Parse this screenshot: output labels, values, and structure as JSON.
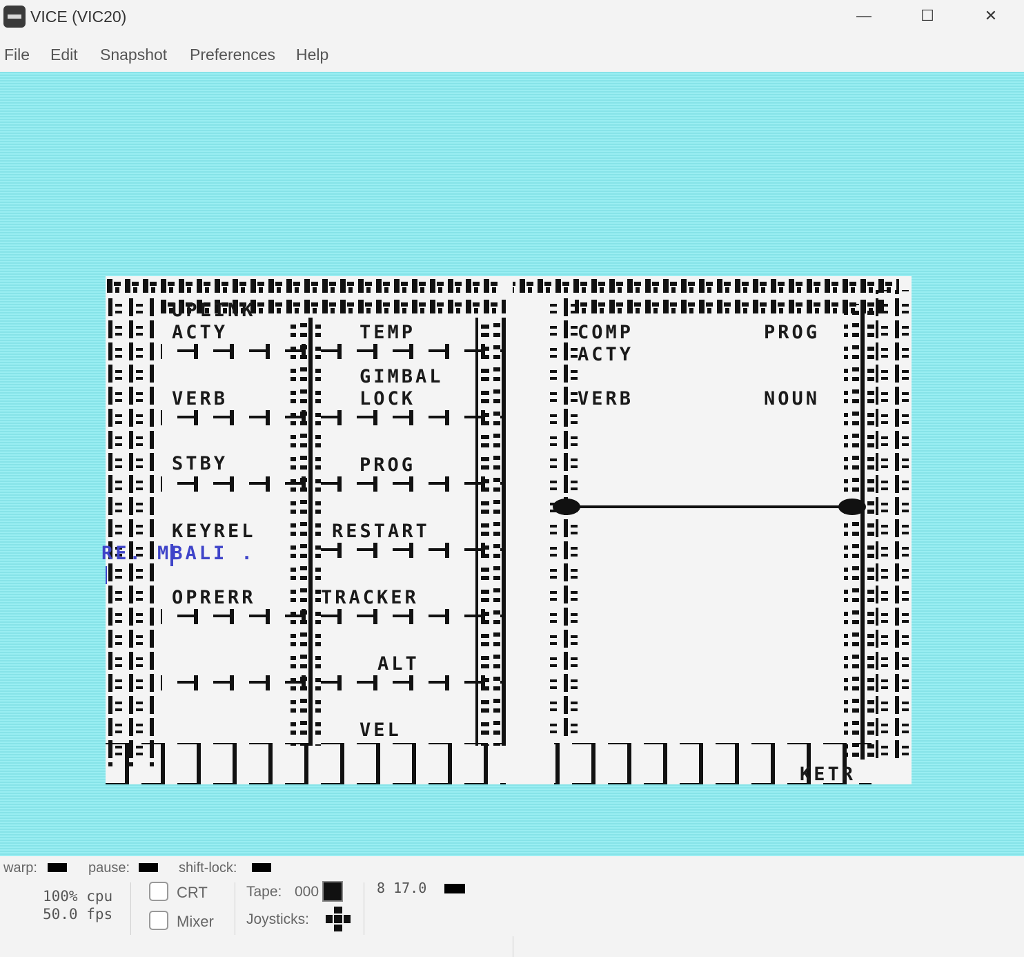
{
  "window": {
    "title": "VICE (VIC20)",
    "controls": {
      "minimize": "—",
      "maximize": "☐",
      "close": "✕"
    }
  },
  "menu": {
    "file": "File",
    "edit": "Edit",
    "snapshot": "Snapshot",
    "preferences": "Preferences",
    "help": "Help"
  },
  "screen": {
    "border_color": "#8ce6eb",
    "background_color": "#f4f4f4",
    "left_panel": {
      "uplink": "UPLINK",
      "acty": "ACTY",
      "temp": "TEMP",
      "gimbal": "GIMBAL",
      "lock": "LOCK",
      "verb": "VERB",
      "stby": "STBY",
      "prog": "PROG",
      "keyrel": "KEYREL",
      "restart": "RESTART",
      "oprerr": "OPRERR",
      "tracker": "TRACKER",
      "alt": "ALT",
      "vel": "VEL"
    },
    "right_panel": {
      "comp": "COMP",
      "prog": "PROG",
      "acty": "ACTY",
      "verb": "VERB",
      "noun": "NOUN",
      "key": "KETR"
    },
    "overlay_text": "RE. MBALI .",
    "overlay_color": "#3f44c9"
  },
  "status": {
    "warp_label": "warp:",
    "pause_label": "pause:",
    "shiftlock_label": "shift-lock:",
    "cpu": "100% cpu",
    "fps": "50.0 fps",
    "crt_label": "CRT",
    "mixer_label": "Mixer",
    "tape_label": "Tape:",
    "tape_counter": "000",
    "joysticks_label": "Joysticks:",
    "drive_info": "8 17.0"
  }
}
